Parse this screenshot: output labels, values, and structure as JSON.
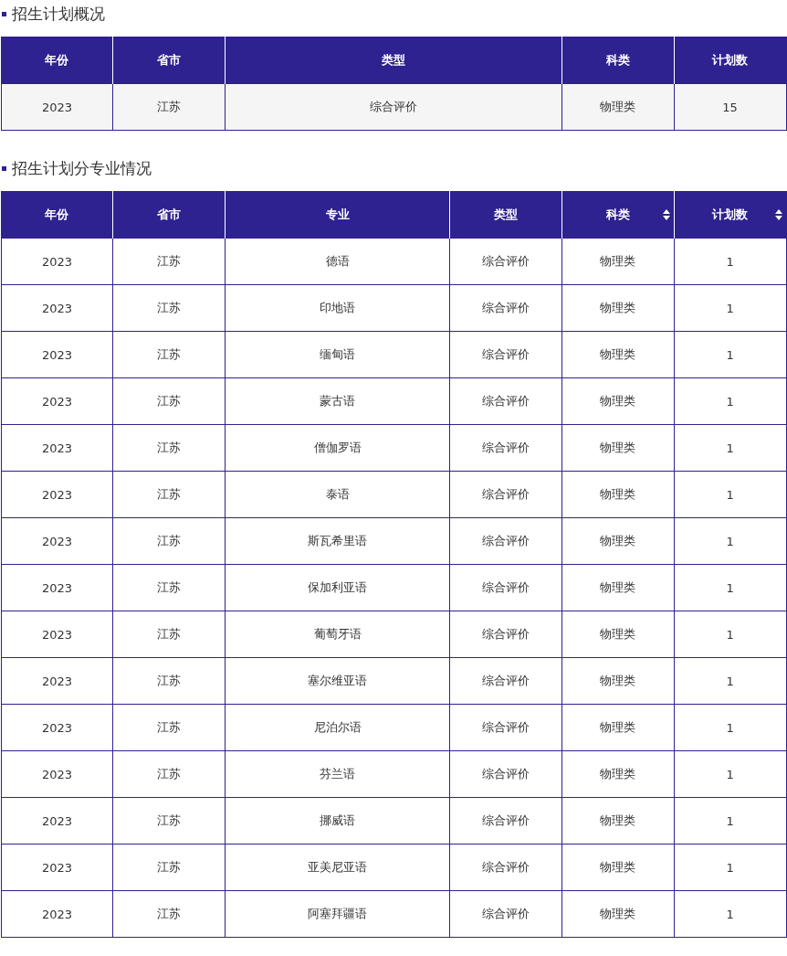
{
  "sections": [
    {
      "title": "招生计划概况",
      "columns": [
        {
          "label": "年份",
          "sortable": false
        },
        {
          "label": "省市",
          "sortable": false
        },
        {
          "label": "类型",
          "sortable": false
        },
        {
          "label": "科类",
          "sortable": false
        },
        {
          "label": "计划数",
          "sortable": false
        }
      ],
      "rows": [
        [
          "2023",
          "江苏",
          "综合评价",
          "物理类",
          "15"
        ]
      ]
    },
    {
      "title": "招生计划分专业情况",
      "columns": [
        {
          "label": "年份",
          "sortable": false
        },
        {
          "label": "省市",
          "sortable": false
        },
        {
          "label": "专业",
          "sortable": false
        },
        {
          "label": "类型",
          "sortable": false
        },
        {
          "label": "科类",
          "sortable": true
        },
        {
          "label": "计划数",
          "sortable": true
        }
      ],
      "rows": [
        [
          "2023",
          "江苏",
          "德语",
          "综合评价",
          "物理类",
          "1"
        ],
        [
          "2023",
          "江苏",
          "印地语",
          "综合评价",
          "物理类",
          "1"
        ],
        [
          "2023",
          "江苏",
          "缅甸语",
          "综合评价",
          "物理类",
          "1"
        ],
        [
          "2023",
          "江苏",
          "蒙古语",
          "综合评价",
          "物理类",
          "1"
        ],
        [
          "2023",
          "江苏",
          "僧伽罗语",
          "综合评价",
          "物理类",
          "1"
        ],
        [
          "2023",
          "江苏",
          "泰语",
          "综合评价",
          "物理类",
          "1"
        ],
        [
          "2023",
          "江苏",
          "斯瓦希里语",
          "综合评价",
          "物理类",
          "1"
        ],
        [
          "2023",
          "江苏",
          "保加利亚语",
          "综合评价",
          "物理类",
          "1"
        ],
        [
          "2023",
          "江苏",
          "葡萄牙语",
          "综合评价",
          "物理类",
          "1"
        ],
        [
          "2023",
          "江苏",
          "塞尔维亚语",
          "综合评价",
          "物理类",
          "1"
        ],
        [
          "2023",
          "江苏",
          "尼泊尔语",
          "综合评价",
          "物理类",
          "1"
        ],
        [
          "2023",
          "江苏",
          "芬兰语",
          "综合评价",
          "物理类",
          "1"
        ],
        [
          "2023",
          "江苏",
          "挪威语",
          "综合评价",
          "物理类",
          "1"
        ],
        [
          "2023",
          "江苏",
          "亚美尼亚语",
          "综合评价",
          "物理类",
          "1"
        ],
        [
          "2023",
          "江苏",
          "阿塞拜疆语",
          "综合评价",
          "物理类",
          "1"
        ]
      ]
    }
  ]
}
